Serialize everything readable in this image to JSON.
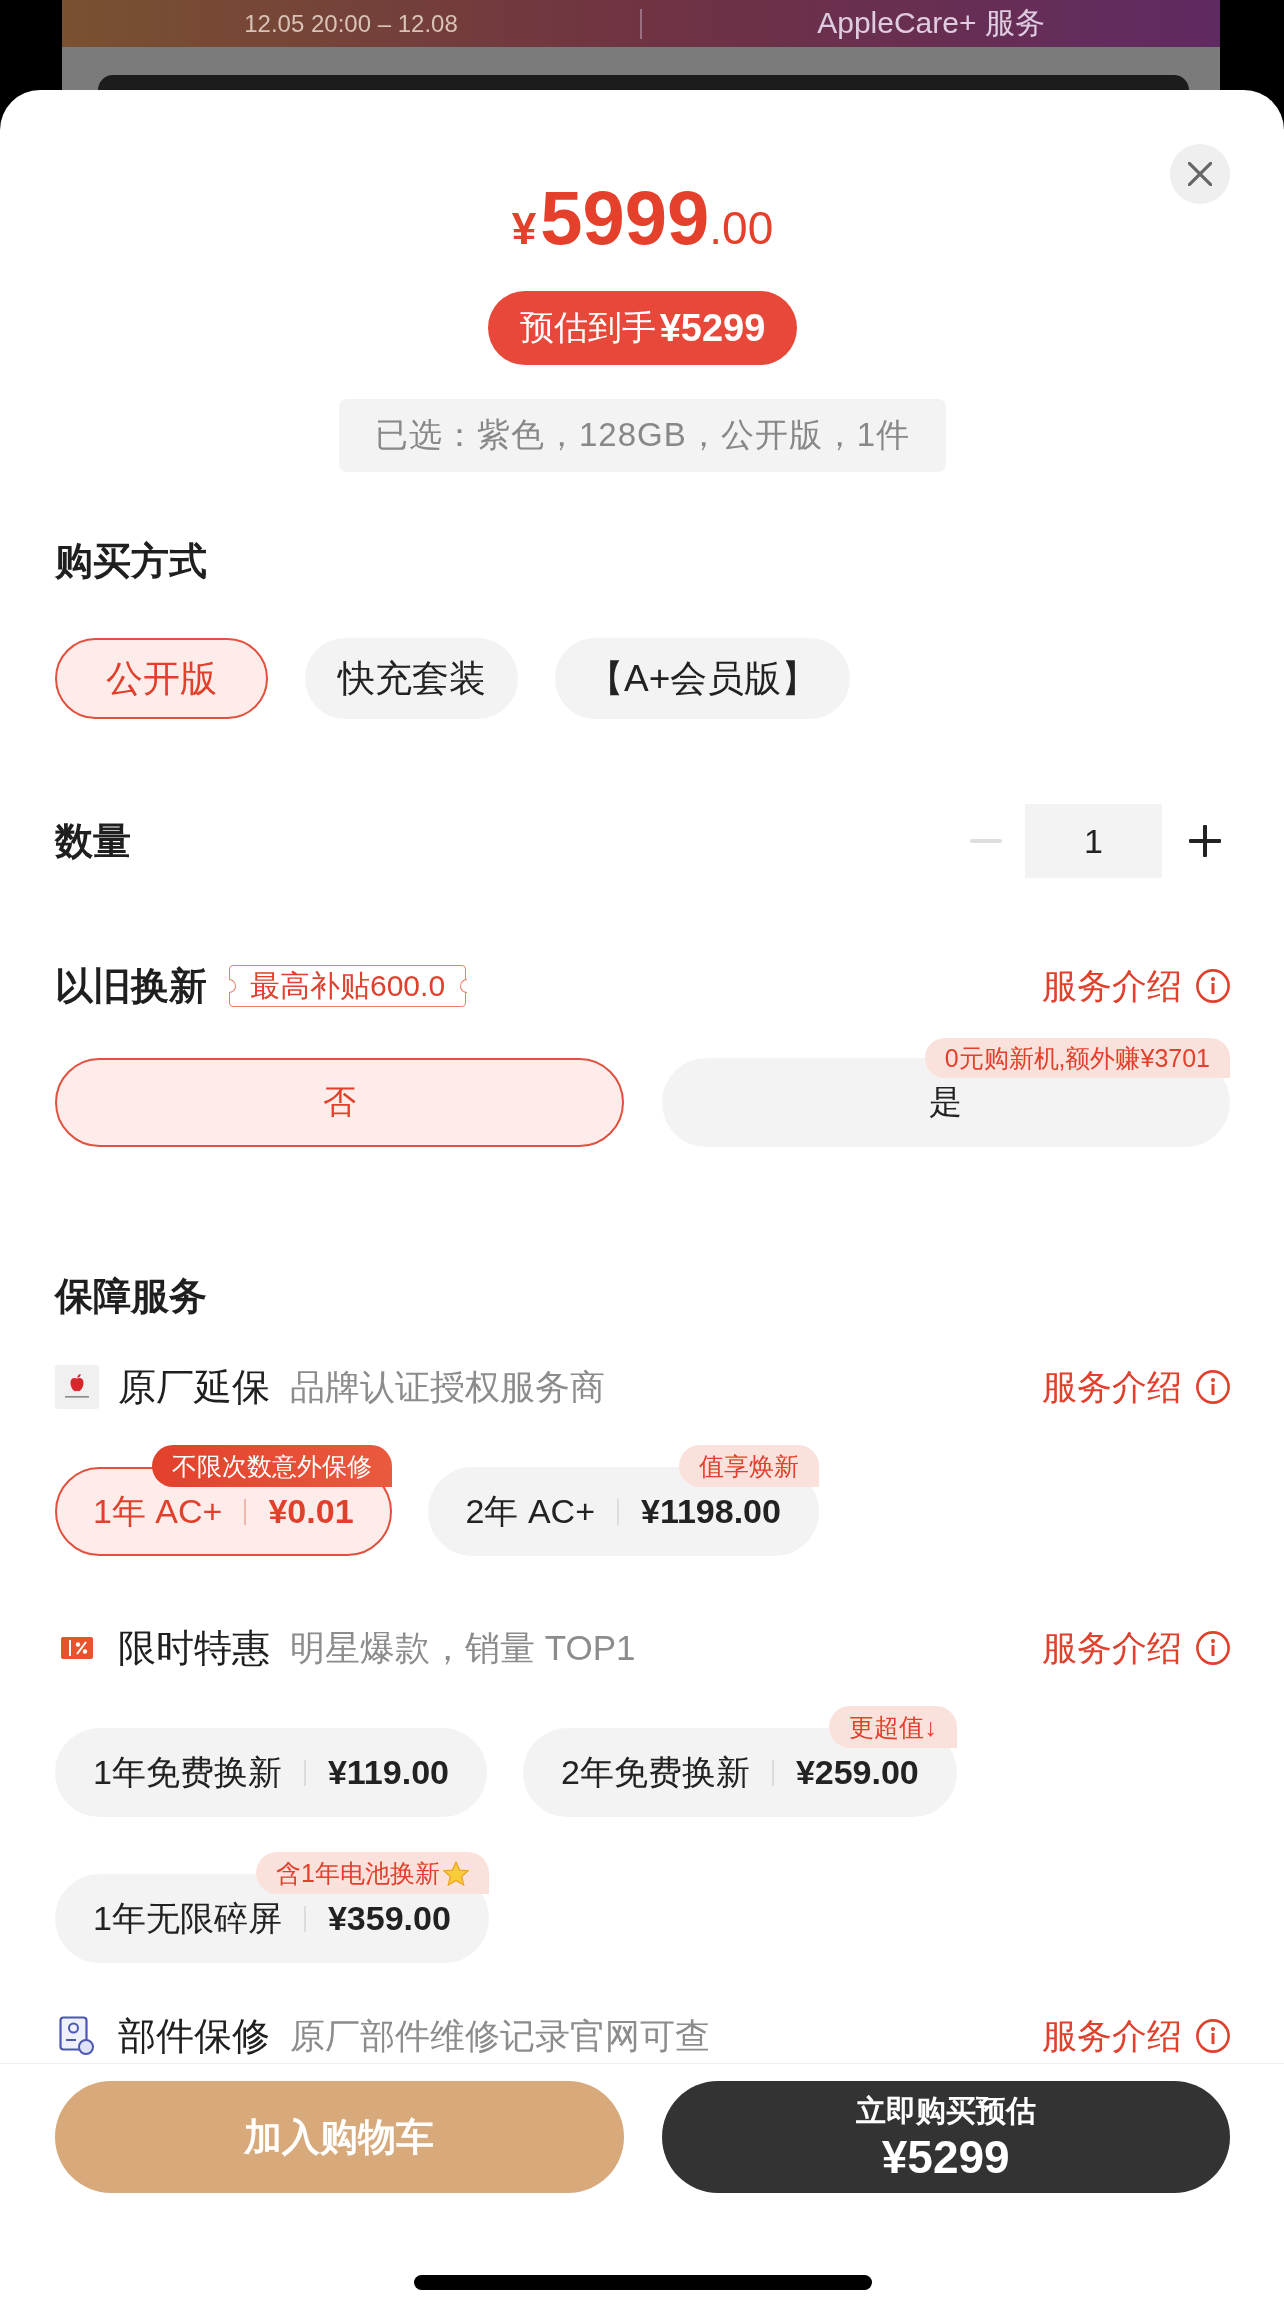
{
  "backdrop": {
    "banner": {
      "date_range": "12.05 20:00 – 12.08",
      "title": "AppleCare+ 服务"
    }
  },
  "header": {
    "price": {
      "symbol": "¥",
      "integer": "5999",
      "decimal": ".00"
    },
    "estimate": {
      "label": "预估到手",
      "amount": "¥5299"
    },
    "selection_summary": "已选：紫色，128GB，公开版，1件"
  },
  "purchase_method": {
    "title": "购买方式",
    "options": [
      {
        "label": "公开版",
        "selected": true
      },
      {
        "label": "快充套装",
        "selected": false
      },
      {
        "label": "【A+会员版】",
        "selected": false
      }
    ]
  },
  "quantity": {
    "title": "数量",
    "value": "1",
    "decrease_disabled": true
  },
  "trade_in": {
    "title": "以旧换新",
    "tag": "最高补贴600.0",
    "info_link": "服务介绍",
    "options": [
      {
        "label": "否",
        "selected": true
      },
      {
        "label": "是",
        "selected": false,
        "badge": "0元购新机,额外赚¥3701"
      }
    ]
  },
  "protection": {
    "title": "保障服务",
    "groups": [
      {
        "kind": "applecare",
        "name": "原厂延保",
        "subtitle": "品牌认证授权服务商",
        "info_link": "服务介绍",
        "plans": [
          {
            "name": "1年 AC+",
            "price": "¥0.01",
            "selected": true,
            "badge": "不限次数意外保修"
          },
          {
            "name": "2年 AC+",
            "price": "¥1198.00",
            "selected": false,
            "badge": "值享焕新"
          }
        ]
      },
      {
        "kind": "offer",
        "name": "限时特惠",
        "subtitle": "明星爆款，销量 TOP1",
        "info_link": "服务介绍",
        "plans": [
          {
            "name": "1年免费换新",
            "price": "¥119.00",
            "selected": false
          },
          {
            "name": "2年免费换新",
            "price": "¥259.00",
            "selected": false,
            "badge": "更超值↓"
          },
          {
            "name": "1年无限碎屏",
            "price": "¥359.00",
            "selected": false,
            "badge": "含1年电池换新",
            "badge_star": true
          }
        ]
      },
      {
        "kind": "parts",
        "name": "部件保修",
        "subtitle": "原厂部件维修记录官网可查",
        "info_link": "服务介绍"
      }
    ]
  },
  "footer": {
    "cart_button": "加入购物车",
    "buy_button": {
      "label": "立即购买预估",
      "amount": "¥5299"
    }
  }
}
